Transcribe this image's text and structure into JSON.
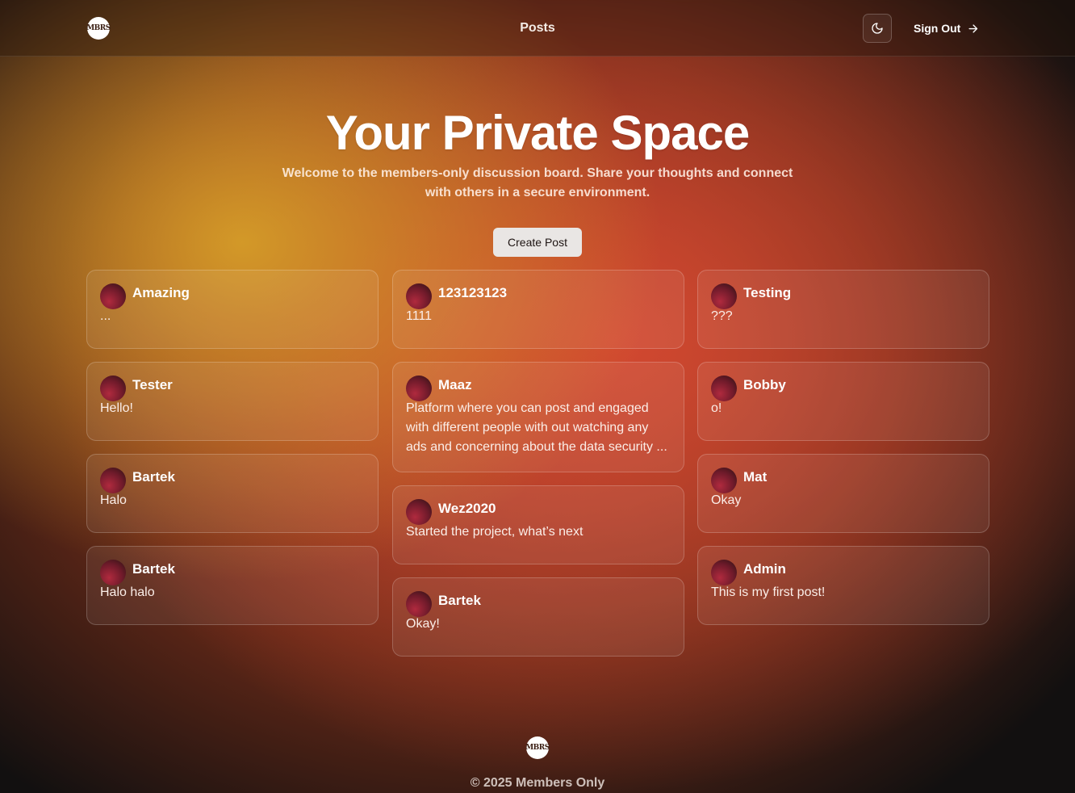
{
  "header": {
    "logo_text": "MBRS",
    "nav_title": "Posts",
    "theme_icon": "moon-icon",
    "sign_out_label": "Sign Out",
    "sign_out_icon": "arrow-right-icon"
  },
  "hero": {
    "title": "Your Private Space",
    "subtitle": "Welcome to the members-only discussion board. Share your thoughts and connect with others in a secure environment.",
    "create_post_label": "Create Post"
  },
  "posts": {
    "column1": [
      {
        "author": "Amazing",
        "content": "..."
      },
      {
        "author": "Tester",
        "content": "Hello!"
      },
      {
        "author": "Bartek",
        "content": "Halo"
      },
      {
        "author": "Bartek",
        "content": "Halo halo"
      }
    ],
    "column2": [
      {
        "author": "123123123",
        "content": "1111"
      },
      {
        "author": "Maaz",
        "content": "Platform where you can post and engaged with different people with out watching any ads and concerning about the data security ..."
      },
      {
        "author": "Wez2020",
        "content": "Started the project, what’s next"
      },
      {
        "author": "Bartek",
        "content": "Okay!"
      }
    ],
    "column3": [
      {
        "author": "Testing",
        "content": "???"
      },
      {
        "author": "Bobby",
        "content": "o!"
      },
      {
        "author": "Mat",
        "content": "Okay"
      },
      {
        "author": "Admin",
        "content": "This is my first post!"
      }
    ]
  },
  "footer": {
    "logo_text": "MBRS",
    "copyright": "© 2025 Members Only"
  }
}
